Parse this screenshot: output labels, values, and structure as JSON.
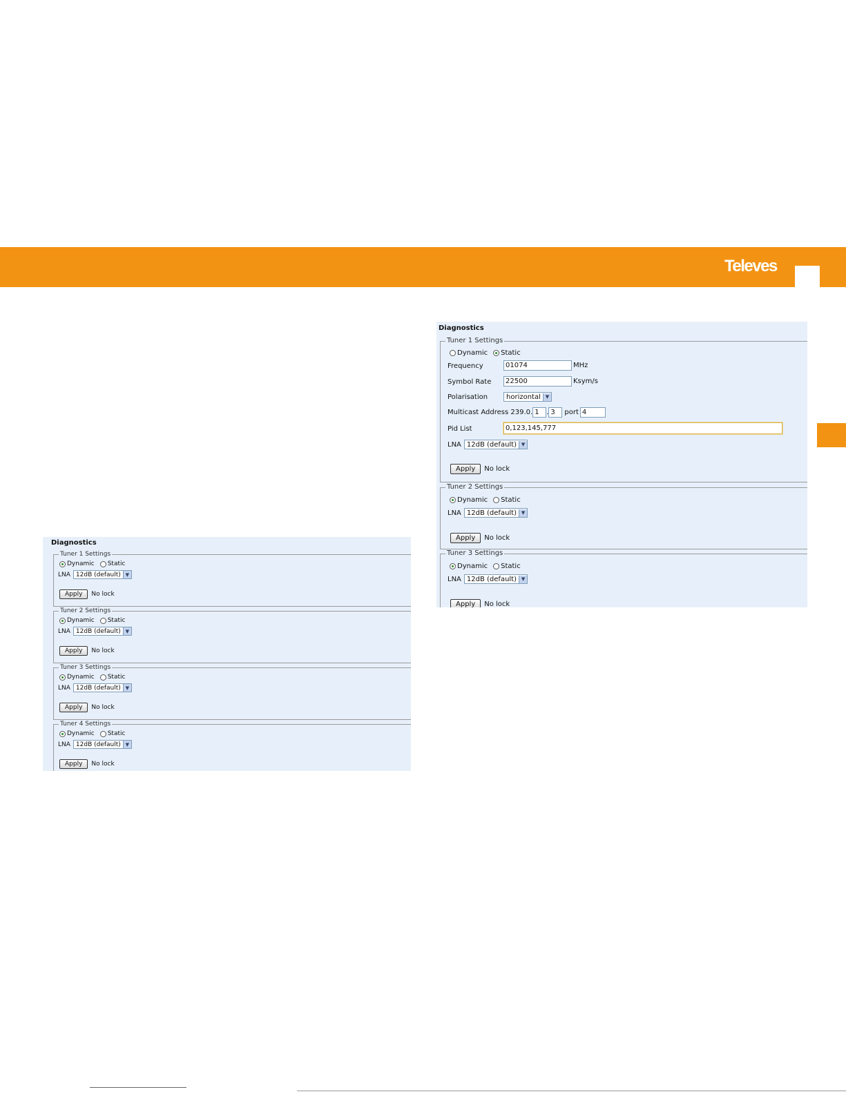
{
  "brand": {
    "name": "Televes"
  },
  "left_panel": {
    "title": "Diagnostics",
    "tuners": [
      {
        "legend": "Tuner 1 Settings",
        "mode_options": [
          "Dynamic",
          "Static"
        ],
        "selected_mode": "Dynamic",
        "lna_label": "LNA",
        "lna_value": "12dB (default)",
        "apply_label": "Apply",
        "status": "No lock"
      },
      {
        "legend": "Tuner 2 Settings",
        "mode_options": [
          "Dynamic",
          "Static"
        ],
        "selected_mode": "Dynamic",
        "lna_label": "LNA",
        "lna_value": "12dB (default)",
        "apply_label": "Apply",
        "status": "No lock"
      },
      {
        "legend": "Tuner 3 Settings",
        "mode_options": [
          "Dynamic",
          "Static"
        ],
        "selected_mode": "Dynamic",
        "lna_label": "LNA",
        "lna_value": "12dB (default)",
        "apply_label": "Apply",
        "status": "No lock"
      },
      {
        "legend": "Tuner 4 Settings",
        "mode_options": [
          "Dynamic",
          "Static"
        ],
        "selected_mode": "Dynamic",
        "lna_label": "LNA",
        "lna_value": "12dB (default)",
        "apply_label": "Apply",
        "status": "No lock"
      }
    ]
  },
  "right_panel": {
    "title": "Diagnostics",
    "tuner1": {
      "legend": "Tuner 1 Settings",
      "mode_options": [
        "Dynamic",
        "Static"
      ],
      "selected_mode": "Static",
      "frequency_label": "Frequency",
      "frequency_value": "01074",
      "frequency_unit": "MHz",
      "symbol_rate_label": "Symbol Rate",
      "symbol_rate_value": "22500",
      "symbol_rate_unit": "Ksym/s",
      "polarisation_label": "Polarisation",
      "polarisation_value": "horizontal",
      "multicast_label": "Multicast Address 239.0.",
      "multicast_octet3": "1",
      "multicast_sep": ".",
      "multicast_octet4": "3",
      "port_label": "port",
      "port_value": "4",
      "pid_list_label": "Pid List",
      "pid_list_value": "0,123,145,777",
      "lna_label": "LNA",
      "lna_value": "12dB (default)",
      "apply_label": "Apply",
      "status": "No lock"
    },
    "tuners": [
      {
        "legend": "Tuner 2 Settings",
        "mode_options": [
          "Dynamic",
          "Static"
        ],
        "selected_mode": "Dynamic",
        "lna_label": "LNA",
        "lna_value": "12dB (default)",
        "apply_label": "Apply",
        "status": "No lock"
      },
      {
        "legend": "Tuner 3 Settings",
        "mode_options": [
          "Dynamic",
          "Static"
        ],
        "selected_mode": "Dynamic",
        "lna_label": "LNA",
        "lna_value": "12dB (default)",
        "apply_label": "Apply",
        "status": "No lock"
      }
    ]
  },
  "colors": {
    "banner": "#f39313",
    "panel_bg": "#e7f0fa",
    "brand_text": "#ffffff"
  },
  "icons": [
    "radio-selected-icon",
    "radio-unselected-icon",
    "dropdown-arrow-icon"
  ]
}
